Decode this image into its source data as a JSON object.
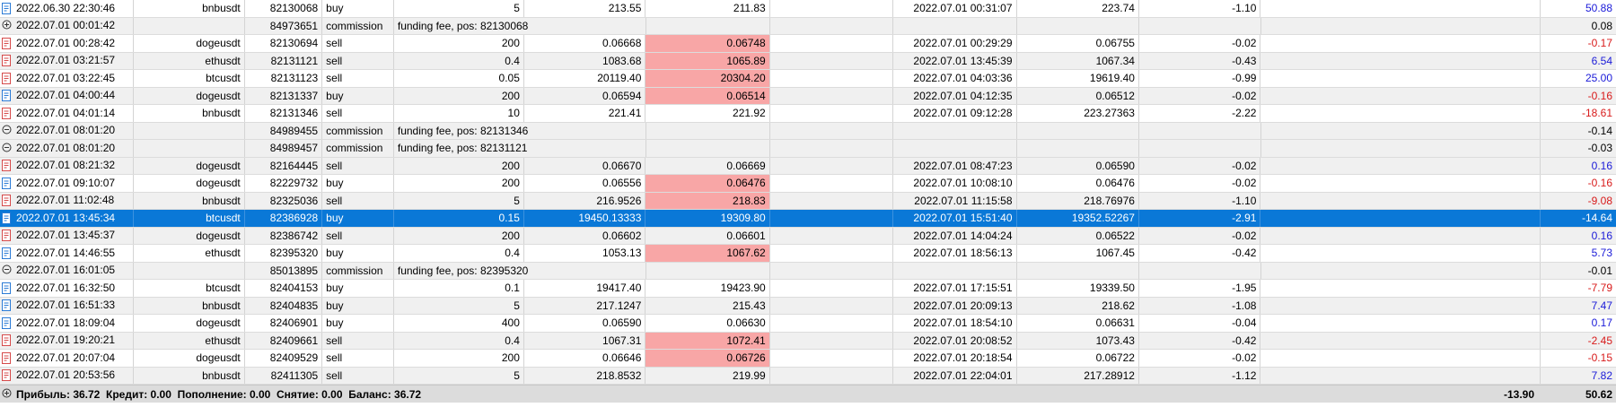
{
  "colors": {
    "selected_row": "#0a78d7",
    "highlight_cell": "#f8a6a6",
    "profit_positive": "#1a1ad8",
    "profit_negative": "#d81a1a",
    "buy_icon": "#2b7bd6",
    "sell_icon": "#d64a4a"
  },
  "rows": [
    {
      "kind": "trade",
      "icon": "buy-order-icon",
      "time": "2022.06.30 22:30:46",
      "symbol": "bnbusdt",
      "ticket": "82130068",
      "type": "buy",
      "volume": "5",
      "price": "213.55",
      "sl": "211.83",
      "tp": "",
      "close_time": "2022.07.01 00:31:07",
      "close_price": "223.74",
      "commission": "-1.10",
      "fee": "",
      "profit": "50.88",
      "sign": "pos",
      "hl": false
    },
    {
      "kind": "balance",
      "icon": "plus-circle-icon",
      "time": "2022.07.01 00:01:42",
      "ticket": "84973651",
      "type": "commission",
      "comment": "funding fee, pos: 82130068",
      "profit": "0.08",
      "sign": ""
    },
    {
      "kind": "trade",
      "icon": "sell-order-icon",
      "time": "2022.07.01 00:28:42",
      "symbol": "dogeusdt",
      "ticket": "82130694",
      "type": "sell",
      "volume": "200",
      "price": "0.06668",
      "sl": "0.06748",
      "tp": "",
      "close_time": "2022.07.01 00:29:29",
      "close_price": "0.06755",
      "commission": "-0.02",
      "fee": "",
      "profit": "-0.17",
      "sign": "neg",
      "hl": true
    },
    {
      "kind": "trade",
      "icon": "sell-order-icon",
      "time": "2022.07.01 03:21:57",
      "symbol": "ethusdt",
      "ticket": "82131121",
      "type": "sell",
      "volume": "0.4",
      "price": "1083.68",
      "sl": "1065.89",
      "tp": "",
      "close_time": "2022.07.01 13:45:39",
      "close_price": "1067.34",
      "commission": "-0.43",
      "fee": "",
      "profit": "6.54",
      "sign": "pos",
      "hl": true
    },
    {
      "kind": "trade",
      "icon": "sell-order-icon",
      "time": "2022.07.01 03:22:45",
      "symbol": "btcusdt",
      "ticket": "82131123",
      "type": "sell",
      "volume": "0.05",
      "price": "20119.40",
      "sl": "20304.20",
      "tp": "",
      "close_time": "2022.07.01 04:03:36",
      "close_price": "19619.40",
      "commission": "-0.99",
      "fee": "",
      "profit": "25.00",
      "sign": "pos",
      "hl": true
    },
    {
      "kind": "trade",
      "icon": "buy-order-icon",
      "time": "2022.07.01 04:00:44",
      "symbol": "dogeusdt",
      "ticket": "82131337",
      "type": "buy",
      "volume": "200",
      "price": "0.06594",
      "sl": "0.06514",
      "tp": "",
      "close_time": "2022.07.01 04:12:35",
      "close_price": "0.06512",
      "commission": "-0.02",
      "fee": "",
      "profit": "-0.16",
      "sign": "neg",
      "hl": true
    },
    {
      "kind": "trade",
      "icon": "sell-order-icon",
      "time": "2022.07.01 04:01:14",
      "symbol": "bnbusdt",
      "ticket": "82131346",
      "type": "sell",
      "volume": "10",
      "price": "221.41",
      "sl": "221.92",
      "tp": "",
      "close_time": "2022.07.01 09:12:28",
      "close_price": "223.27363",
      "commission": "-2.22",
      "fee": "",
      "profit": "-18.61",
      "sign": "neg",
      "hl": false
    },
    {
      "kind": "balance",
      "icon": "minus-circle-icon",
      "time": "2022.07.01 08:01:20",
      "ticket": "84989455",
      "type": "commission",
      "comment": "funding fee, pos: 82131346",
      "profit": "-0.14",
      "sign": ""
    },
    {
      "kind": "balance",
      "icon": "minus-circle-icon",
      "time": "2022.07.01 08:01:20",
      "ticket": "84989457",
      "type": "commission",
      "comment": "funding fee, pos: 82131121",
      "profit": "-0.03",
      "sign": ""
    },
    {
      "kind": "trade",
      "icon": "sell-order-icon",
      "time": "2022.07.01 08:21:32",
      "symbol": "dogeusdt",
      "ticket": "82164445",
      "type": "sell",
      "volume": "200",
      "price": "0.06670",
      "sl": "0.06669",
      "tp": "",
      "close_time": "2022.07.01 08:47:23",
      "close_price": "0.06590",
      "commission": "-0.02",
      "fee": "",
      "profit": "0.16",
      "sign": "pos",
      "hl": false
    },
    {
      "kind": "trade",
      "icon": "buy-order-icon",
      "time": "2022.07.01 09:10:07",
      "symbol": "dogeusdt",
      "ticket": "82229732",
      "type": "buy",
      "volume": "200",
      "price": "0.06556",
      "sl": "0.06476",
      "tp": "",
      "close_time": "2022.07.01 10:08:10",
      "close_price": "0.06476",
      "commission": "-0.02",
      "fee": "",
      "profit": "-0.16",
      "sign": "neg",
      "hl": true
    },
    {
      "kind": "trade",
      "icon": "sell-order-icon",
      "time": "2022.07.01 11:02:48",
      "symbol": "bnbusdt",
      "ticket": "82325036",
      "type": "sell",
      "volume": "5",
      "price": "216.9526",
      "sl": "218.83",
      "tp": "",
      "close_time": "2022.07.01 11:15:58",
      "close_price": "218.76976",
      "commission": "-1.10",
      "fee": "",
      "profit": "-9.08",
      "sign": "neg",
      "hl": true
    },
    {
      "kind": "trade",
      "icon": "buy-order-icon",
      "time": "2022.07.01 13:45:34",
      "symbol": "btcusdt",
      "ticket": "82386928",
      "type": "buy",
      "volume": "0.15",
      "price": "19450.13333",
      "sl": "19309.80",
      "tp": "",
      "close_time": "2022.07.01 15:51:40",
      "close_price": "19352.52267",
      "commission": "-2.91",
      "fee": "",
      "profit": "-14.64",
      "sign": "neg",
      "hl": false,
      "selected": true
    },
    {
      "kind": "trade",
      "icon": "sell-order-icon",
      "time": "2022.07.01 13:45:37",
      "symbol": "dogeusdt",
      "ticket": "82386742",
      "type": "sell",
      "volume": "200",
      "price": "0.06602",
      "sl": "0.06601",
      "tp": "",
      "close_time": "2022.07.01 14:04:24",
      "close_price": "0.06522",
      "commission": "-0.02",
      "fee": "",
      "profit": "0.16",
      "sign": "pos",
      "hl": false
    },
    {
      "kind": "trade",
      "icon": "buy-order-icon",
      "time": "2022.07.01 14:46:55",
      "symbol": "ethusdt",
      "ticket": "82395320",
      "type": "buy",
      "volume": "0.4",
      "price": "1053.13",
      "sl": "1067.62",
      "tp": "",
      "close_time": "2022.07.01 18:56:13",
      "close_price": "1067.45",
      "commission": "-0.42",
      "fee": "",
      "profit": "5.73",
      "sign": "pos",
      "hl": true
    },
    {
      "kind": "balance",
      "icon": "minus-circle-icon",
      "time": "2022.07.01 16:01:05",
      "ticket": "85013895",
      "type": "commission",
      "comment": "funding fee, pos: 82395320",
      "profit": "-0.01",
      "sign": ""
    },
    {
      "kind": "trade",
      "icon": "buy-order-icon",
      "time": "2022.07.01 16:32:50",
      "symbol": "btcusdt",
      "ticket": "82404153",
      "type": "buy",
      "volume": "0.1",
      "price": "19417.40",
      "sl": "19423.90",
      "tp": "",
      "close_time": "2022.07.01 17:15:51",
      "close_price": "19339.50",
      "commission": "-1.95",
      "fee": "",
      "profit": "-7.79",
      "sign": "neg",
      "hl": false
    },
    {
      "kind": "trade",
      "icon": "buy-order-icon",
      "time": "2022.07.01 16:51:33",
      "symbol": "bnbusdt",
      "ticket": "82404835",
      "type": "buy",
      "volume": "5",
      "price": "217.1247",
      "sl": "215.43",
      "tp": "",
      "close_time": "2022.07.01 20:09:13",
      "close_price": "218.62",
      "commission": "-1.08",
      "fee": "",
      "profit": "7.47",
      "sign": "pos",
      "hl": false
    },
    {
      "kind": "trade",
      "icon": "buy-order-icon",
      "time": "2022.07.01 18:09:04",
      "symbol": "dogeusdt",
      "ticket": "82406901",
      "type": "buy",
      "volume": "400",
      "price": "0.06590",
      "sl": "0.06630",
      "tp": "",
      "close_time": "2022.07.01 18:54:10",
      "close_price": "0.06631",
      "commission": "-0.04",
      "fee": "",
      "profit": "0.17",
      "sign": "pos",
      "hl": false
    },
    {
      "kind": "trade",
      "icon": "sell-order-icon",
      "time": "2022.07.01 19:20:21",
      "symbol": "ethusdt",
      "ticket": "82409661",
      "type": "sell",
      "volume": "0.4",
      "price": "1067.31",
      "sl": "1072.41",
      "tp": "",
      "close_time": "2022.07.01 20:08:52",
      "close_price": "1073.43",
      "commission": "-0.42",
      "fee": "",
      "profit": "-2.45",
      "sign": "neg",
      "hl": true
    },
    {
      "kind": "trade",
      "icon": "sell-order-icon",
      "time": "2022.07.01 20:07:04",
      "symbol": "dogeusdt",
      "ticket": "82409529",
      "type": "sell",
      "volume": "200",
      "price": "0.06646",
      "sl": "0.06726",
      "tp": "",
      "close_time": "2022.07.01 20:18:54",
      "close_price": "0.06722",
      "commission": "-0.02",
      "fee": "",
      "profit": "-0.15",
      "sign": "neg",
      "hl": true
    },
    {
      "kind": "trade",
      "icon": "sell-order-icon",
      "time": "2022.07.01 20:53:56",
      "symbol": "bnbusdt",
      "ticket": "82411305",
      "type": "sell",
      "volume": "5",
      "price": "218.8532",
      "sl": "219.99",
      "tp": "",
      "close_time": "2022.07.01 22:04:01",
      "close_price": "217.28912",
      "commission": "-1.12",
      "fee": "",
      "profit": "7.82",
      "sign": "pos",
      "hl": false
    }
  ],
  "footer": {
    "icon": "plus-circle-icon",
    "summary": "Прибыль: 36.72  Кредит: 0.00  Пополнение: 0.00  Снятие: 0.00  Баланс: 36.72",
    "commission_total": "-13.90",
    "profit_total": "50.62"
  }
}
